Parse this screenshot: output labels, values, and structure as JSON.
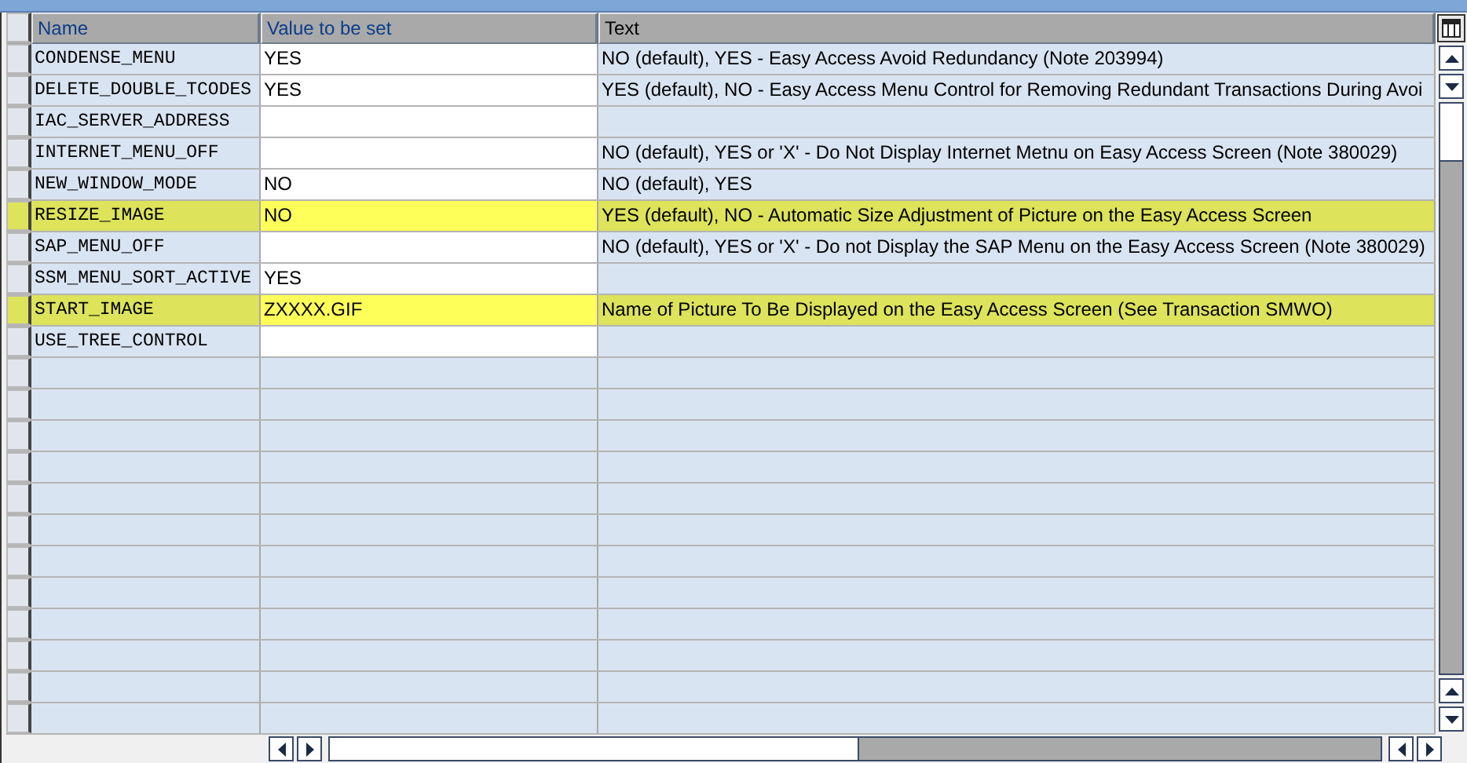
{
  "table": {
    "columns": [
      "Name",
      "Value to be set",
      "Text"
    ],
    "rows": [
      {
        "name": "CONDENSE_MENU",
        "value": "YES",
        "text": "NO (default), YES - Easy Access Avoid Redundancy (Note 203994)",
        "highlighted": false
      },
      {
        "name": "DELETE_DOUBLE_TCODES",
        "value": "YES",
        "text": "YES (default), NO - Easy Access Menu Control for Removing Redundant Transactions During Avoi",
        "highlighted": false
      },
      {
        "name": "IAC_SERVER_ADDRESS",
        "highlighted": false
      },
      {
        "name": "INTERNET_MENU_OFF",
        "text": "NO (default), YES or 'X' - Do Not Display Internet Metnu on Easy Access Screen  (Note 380029)",
        "highlighted": false
      },
      {
        "name": "NEW_WINDOW_MODE",
        "value": "NO",
        "text": "NO (default), YES",
        "highlighted": false
      },
      {
        "name": "RESIZE_IMAGE",
        "value": "NO",
        "text": "YES (default), NO - Automatic Size Adjustment of Picture on the Easy Access Screen",
        "highlighted": true
      },
      {
        "name": "SAP_MENU_OFF",
        "text": "NO (default), YES or 'X' -  Do not Display the SAP Menu on the Easy Access Screen (Note 380029)",
        "highlighted": false
      },
      {
        "name": "SSM_MENU_SORT_ACTIVE",
        "value": "YES",
        "highlighted": false
      },
      {
        "name": "START_IMAGE",
        "value": "ZXXXX.GIF",
        "text": "Name of Picture To Be Displayed on the Easy Access Screen (See Transaction SMWO)",
        "highlighted": true
      },
      {
        "name": "USE_TREE_CONTROL",
        "highlighted": false
      }
    ]
  }
}
